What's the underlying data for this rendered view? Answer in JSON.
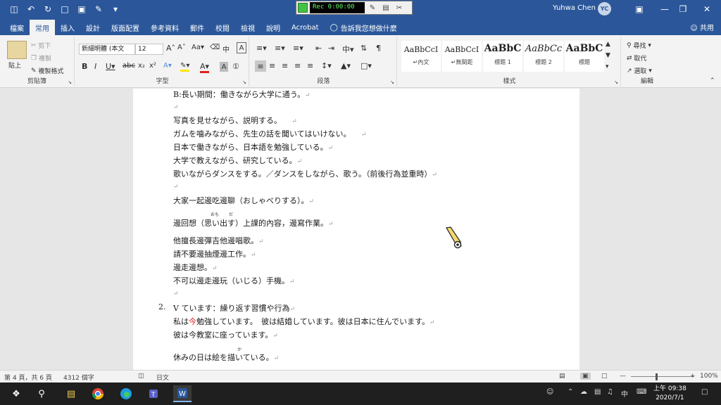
{
  "titlebar": {
    "user_name": "Yuhwa Chen",
    "avatar_initials": "YC",
    "rec_label": "Rec 0:00:00",
    "accent": "#2b579a"
  },
  "tabs": [
    "檔案",
    "常用",
    "插入",
    "設計",
    "版面配置",
    "參考資料",
    "郵件",
    "校閱",
    "檢視",
    "說明",
    "Acrobat"
  ],
  "active_tab": "常用",
  "tell_me": "告訴我您想做什麼",
  "share": "共用",
  "ribbon": {
    "clipboard": {
      "paste": "貼上",
      "cut": "剪下",
      "copy": "複製",
      "format_painter": "複製格式",
      "label": "剪貼簿"
    },
    "font": {
      "name": "新細明體 (本文",
      "size": "12",
      "label": "字型"
    },
    "paragraph": {
      "label": "段落"
    },
    "styles": {
      "label": "樣式",
      "items": [
        {
          "sample": "AaBbCcI",
          "name": "↵內文"
        },
        {
          "sample": "AaBbCcI",
          "name": "↵無間距"
        },
        {
          "sample": "AaBbC",
          "name": "標題 1"
        },
        {
          "sample": "AaBbCc",
          "name": "標題 2"
        },
        {
          "sample": "AaBbC",
          "name": "標題"
        }
      ]
    },
    "editing": {
      "find": "尋找",
      "replace": "取代",
      "select": "選取",
      "label": "編輯"
    }
  },
  "document": {
    "lines": [
      "B:長い期間：働きながら大学に通う。",
      "",
      "写真を見せながら、説明する。",
      "ガムを噛みながら、先生の話を聞いてはいけない。",
      "日本で働きながら、日本語を勉強している。",
      "大学で教えながら、研究している。",
      "歌いながらダンスをする。／ダンスをしながら、歌う。（前後行為並重時）",
      "",
      "大家一起邊吃邊聊（おしゃべりする）。",
      "邊回想（思い出す）上課的內容，邊寫作業。",
      "他擅長邊彈吉他邊唱歌。",
      "請不要邊抽煙邊工作。",
      "邊走邊想。",
      "不可以邊走邊玩（いじる）手機。",
      "",
      "V ています：繰り返す習慣や行為",
      "私は",
      "今",
      "勉強しています。　彼は結婚しています。彼は日本に住んでいます。",
      "彼は今教室に座っています。",
      "休みの日は絵を描いている。"
    ],
    "list_number": "2.",
    "ruby_omoi": "おも",
    "ruby_da": "だ",
    "ruby_ka": "か",
    "para_mark": "↵"
  },
  "statusbar": {
    "page": "第 4 頁，共 6 頁",
    "words": "4312 個字",
    "language": "日文",
    "zoom": "100%"
  },
  "taskbar": {
    "time": "上午 09:38",
    "date": "2020/7/1"
  }
}
